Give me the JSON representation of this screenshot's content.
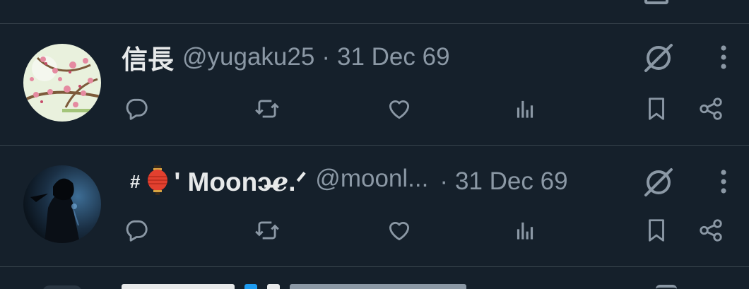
{
  "posts": [
    {
      "name": "信長",
      "handle": "@yugaku25",
      "separator": "·",
      "time": "31 Dec 69"
    },
    {
      "name_prefix": "#",
      "name": "' Moonↄ̶ℯ.ᐟ",
      "handle": "@moonl...",
      "separator": "·",
      "time": "31 Dec 69"
    }
  ],
  "colors": {
    "background": "#15202b",
    "text_primary": "#e7e9ea",
    "text_secondary": "#8b98a5",
    "divider": "#38444d"
  },
  "icons": {
    "reply": "reply-icon",
    "repost": "repost-icon",
    "like": "like-icon",
    "views": "views-icon",
    "bookmark": "bookmark-icon",
    "share": "share-icon",
    "grok": "grok-icon",
    "more": "more-icon"
  }
}
